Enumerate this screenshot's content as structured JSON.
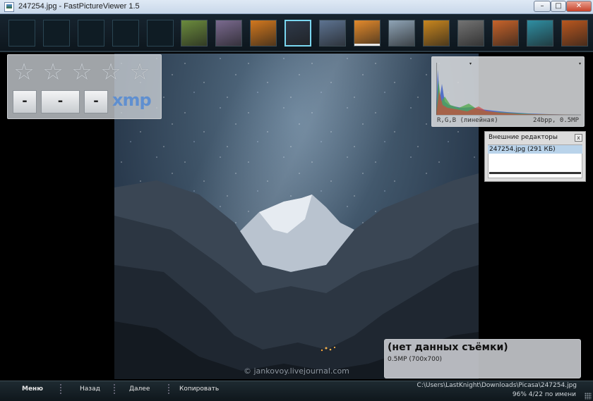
{
  "window": {
    "title": "247254.jpg - FastPictureViewer 1.5",
    "minimize_icon": "minimize-icon",
    "maximize_icon": "maximize-icon",
    "close_icon": "close-icon"
  },
  "thumbnails": {
    "empty_count": 5,
    "items": [
      {
        "color": "#6b8b3d"
      },
      {
        "color": "#7a6a8f"
      },
      {
        "color": "#d2781e"
      },
      {
        "color": "#2f3a4a",
        "selected": true
      },
      {
        "color": "#5d7391"
      },
      {
        "color": "#e38a2c"
      },
      {
        "color": "#8fa4b6"
      },
      {
        "color": "#c8861f"
      },
      {
        "color": "#737373"
      },
      {
        "color": "#c7632a"
      },
      {
        "color": "#2f8fa3"
      },
      {
        "color": "#b9571f"
      },
      {
        "color": "#5c7b3a"
      }
    ]
  },
  "rating": {
    "stars": [
      "☆",
      "☆",
      "☆",
      "☆",
      "☆"
    ],
    "tags": [
      "-",
      "-",
      "-"
    ],
    "xmp_label": "xmp"
  },
  "histogram": {
    "label_left": "R,G,B (линейная)",
    "label_right": "24bpp, 0.5MP",
    "colors": {
      "red": "#d4453a",
      "green": "#4fa84a",
      "blue": "#3f5fc6"
    }
  },
  "editors": {
    "title": "Внешние редакторы",
    "close": "x",
    "item": "247254.jpg (291 КБ)"
  },
  "info": {
    "title": "(нет данных съёмки)",
    "subtitle": "0.5MP (700x700)"
  },
  "watermark": "© jankovoy.livejournal.com",
  "bottombar": {
    "menu": "Меню",
    "back": "Назад",
    "next": "Далее",
    "copy": "Копировать",
    "path": "C:\\Users\\LastKnight\\Downloads\\Picasa\\247254.jpg",
    "status": "96%  4/22  по имени"
  }
}
